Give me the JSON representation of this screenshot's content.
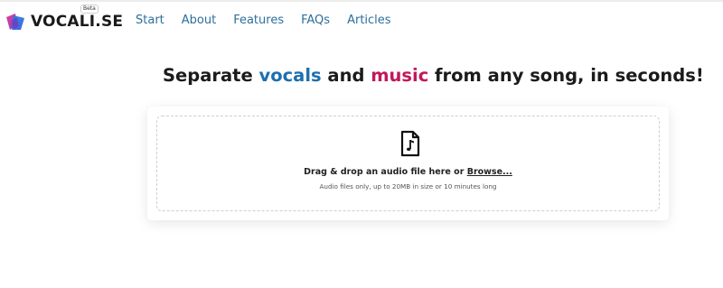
{
  "header": {
    "logo_text": "VOCALI.SE",
    "beta_badge": "Beta",
    "nav": [
      "Start",
      "About",
      "Features",
      "FAQs",
      "Articles"
    ]
  },
  "hero": {
    "part1": "Separate ",
    "vocals": "vocals",
    "part2": " and ",
    "music": "music",
    "part3": " from any song, in seconds!"
  },
  "upload": {
    "icon": "audio-file-icon",
    "title_prefix": "Drag & drop an audio file here or ",
    "browse_label": "Browse...",
    "subtitle": "Audio files only, up to 20MB in size or 10 minutes long"
  },
  "colors": {
    "nav_link": "#2c6f9a",
    "vocals": "#1d6fb0",
    "music": "#c2185b"
  }
}
